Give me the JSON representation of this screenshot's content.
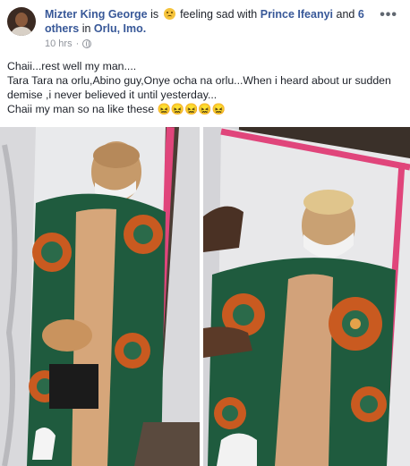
{
  "post": {
    "author": "Mizter King George",
    "is_text": "is",
    "feeling_text": "feeling sad with",
    "tagged_person": "Prince Ifeanyi",
    "and_text": "and",
    "others_text": "6 others",
    "in_text": "in",
    "location": "Orlu, Imo.",
    "time": "10 hrs",
    "more_icon": "more-options-icon",
    "privacy_icon": "globe-icon",
    "lines": [
      "Chaii...rest well my man....",
      "Tara Tara na orlu,Abino guy,Onye ocha na orlu...When i heard about ur sudden demise ,i never believed it until yesterday...",
      "Chaii my man so na like these 😖😖😖😖😖"
    ]
  },
  "colors": {
    "link": "#385898",
    "meta": "#90949c",
    "coffin_pink": "#e0457b",
    "fabric_green": "#1f5b3e",
    "fabric_orange": "#c95a20"
  }
}
